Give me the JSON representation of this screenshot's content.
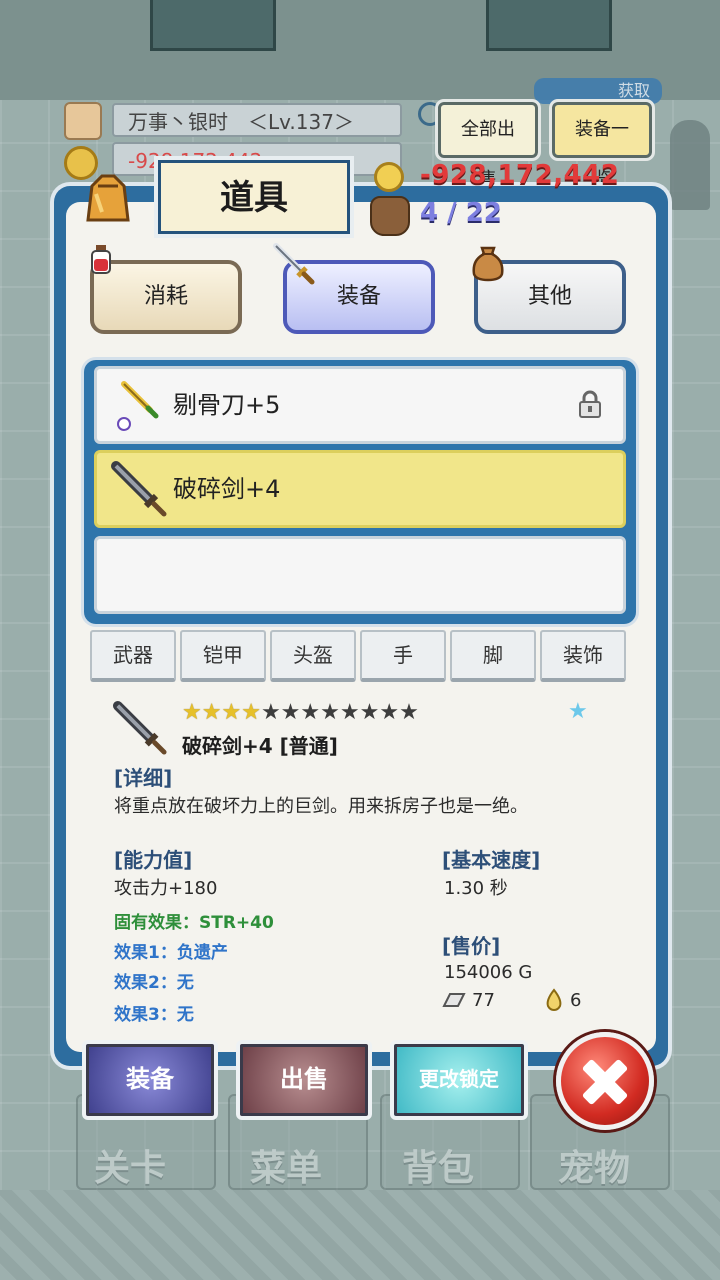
{
  "header": {
    "player_name_level": "万事丶银时　＜Lv.137＞",
    "gold_bar_value": "-928,172,442",
    "sell_all_button": "全部出售",
    "equip_list_button": "装备一览",
    "get_badge": "获取"
  },
  "panel": {
    "title": "道具",
    "gold": "-928,172,442",
    "capacity": "4 / 22",
    "tabs": [
      {
        "label": "消耗"
      },
      {
        "label": "装备"
      },
      {
        "label": "其他"
      }
    ],
    "selected_tab": "装备"
  },
  "items": [
    {
      "name": "剔骨刀+5",
      "locked": true
    },
    {
      "name": "破碎剑+4",
      "selected": true
    },
    {
      "name": ""
    }
  ],
  "slot_tabs": [
    "武器",
    "铠甲",
    "头盔",
    "手",
    "脚",
    "装饰"
  ],
  "detail": {
    "stars_filled": 4,
    "stars_total": 12,
    "name": "破碎剑+4 [普通]",
    "desc_heading": "[详细]",
    "description": "将重点放在破坏力上的巨剑。用来拆房子也是一绝。",
    "stats_heading": "[能力值]",
    "attack": "攻击力+180",
    "inherent_effect": "固有效果：STR+40",
    "effect1": "效果1：负遗产",
    "effect2": "效果2：无",
    "effect3": "效果3：无",
    "speed_heading": "[基本速度]",
    "speed": "1.30 秒",
    "price_heading": "[售价]",
    "price": "154006 G",
    "material1": "77",
    "material2": "6"
  },
  "actions": {
    "equip": "装备",
    "sell": "出售",
    "change_lock": "更改锁定"
  },
  "nav": [
    "关卡",
    "菜单",
    "背包",
    "宠物"
  ],
  "colors": {
    "panel_frame": "#2d6d9f",
    "selected_item": "#f1e68a",
    "gold_text": "#e23a3a",
    "capacity_text": "#7d7fe0",
    "inherent_effect": "#2e8f3a",
    "effect_text": "#2f74c9"
  }
}
